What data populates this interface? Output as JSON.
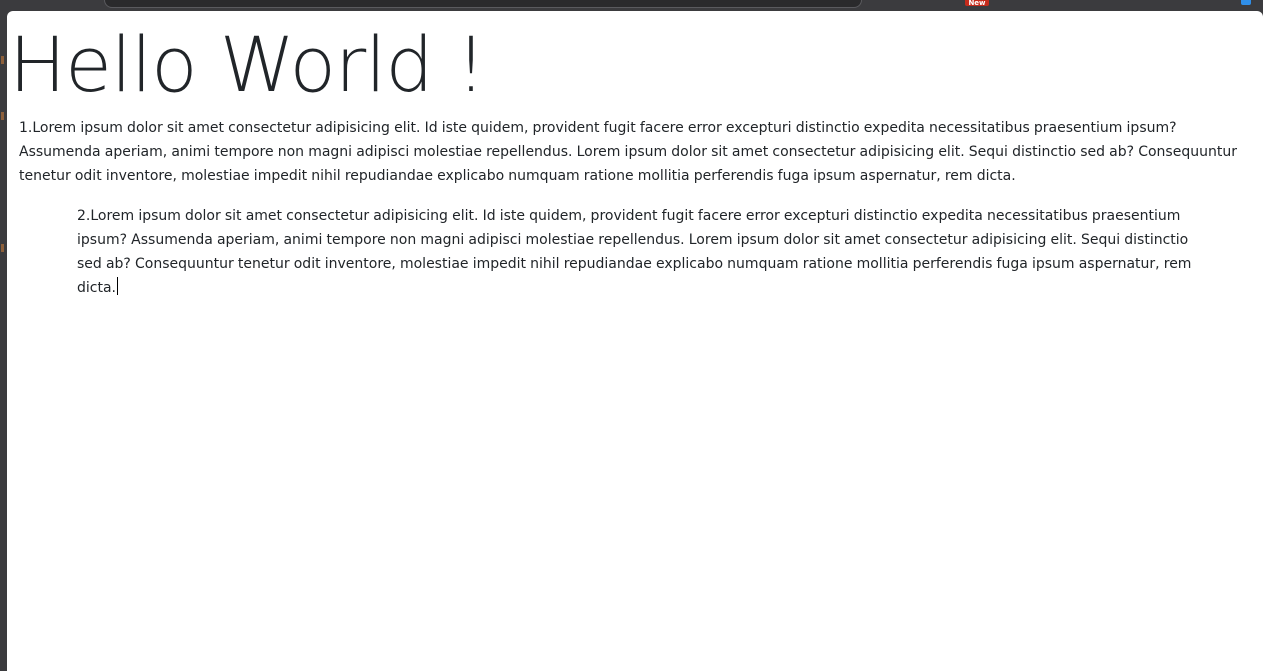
{
  "browser": {
    "badge_text": "New",
    "badge_color": "#c42b1c",
    "accent_color": "#2f8ee8"
  },
  "page": {
    "heading": "Hello World !",
    "paragraph_1": "1.Lorem ipsum dolor sit amet consectetur adipisicing elit. Id iste quidem, provident fugit facere error excepturi distinctio expedita necessitatibus praesentium ipsum? Assumenda aperiam, animi tempore non magni adipisci molestiae repellendus. Lorem ipsum dolor sit amet consectetur adipisicing elit. Sequi distinctio sed ab? Consequuntur tenetur odit inventore, molestiae impedit nihil repudiandae explicabo numquam ratione mollitia perferendis fuga ipsum aspernatur, rem dicta.",
    "paragraph_2": "2.Lorem ipsum dolor sit amet consectetur adipisicing elit. Id iste quidem, provident fugit facere error excepturi distinctio expedita necessitatibus praesentium ipsum? Assumenda aperiam, animi tempore non magni adipisci molestiae repellendus. Lorem ipsum dolor sit amet consectetur adipisicing elit. Sequi distinctio sed ab? Consequuntur tenetur odit inventore, molestiae impedit nihil repudiandae explicabo numquam ratione mollitia perferendis fuga ipsum aspernatur, rem dicta."
  }
}
